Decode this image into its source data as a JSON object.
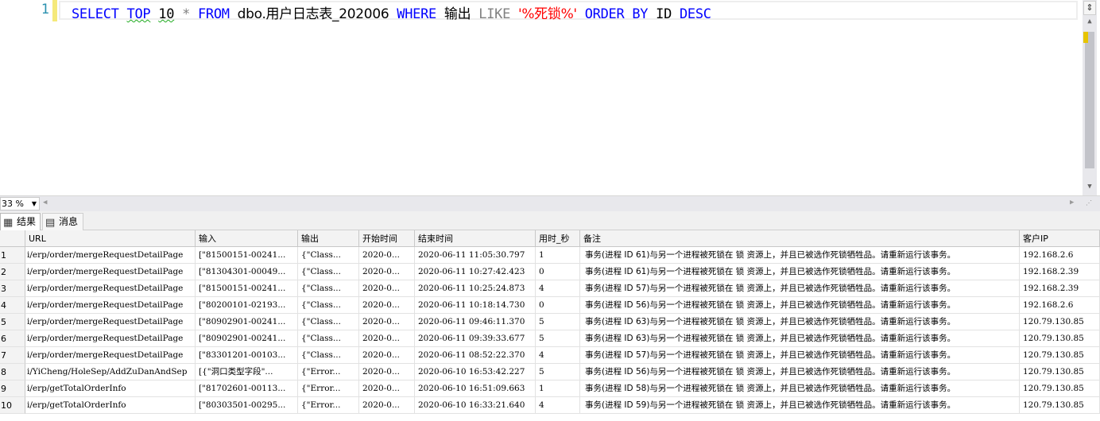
{
  "editor": {
    "line_number": "1",
    "query": {
      "kw_select": "SELECT",
      "kw_top": "TOP",
      "num": "10",
      "star": "*",
      "kw_from": "FROM",
      "table": "dbo.用户日志表_202006",
      "kw_where": "WHERE",
      "col": "输出",
      "kw_like": "LIKE",
      "pattern": "'%死锁%'",
      "kw_order": "ORDER BY",
      "order_col": "ID",
      "kw_desc": "DESC"
    }
  },
  "zoom": {
    "value": "33 %"
  },
  "tabs": {
    "results": "结果",
    "messages": "消息"
  },
  "grid": {
    "columns": [
      "URL",
      "输入",
      "输出",
      "开始时间",
      "结束时间",
      "用时_秒",
      "备注",
      "客户IP"
    ],
    "rows": [
      {
        "n": "1",
        "url": "i/erp/order/mergeRequestDetailPage",
        "input": "[\"81500151-00241...",
        "output": "{\"Class...",
        "start": "2020-0...",
        "end": "2020-06-11 11:05:30.797",
        "secs": "1",
        "note": "事务(进程 ID 61)与另一个进程被死锁在 锁 资源上，并且已被选作死锁牺牲品。请重新运行该事务。",
        "ip": "192.168.2.6"
      },
      {
        "n": "2",
        "url": "i/erp/order/mergeRequestDetailPage",
        "input": "[\"81304301-00049...",
        "output": "{\"Class...",
        "start": "2020-0...",
        "end": "2020-06-11 10:27:42.423",
        "secs": "0",
        "note": "事务(进程 ID 61)与另一个进程被死锁在 锁 资源上，并且已被选作死锁牺牲品。请重新运行该事务。",
        "ip": "192.168.2.39"
      },
      {
        "n": "3",
        "url": "i/erp/order/mergeRequestDetailPage",
        "input": "[\"81500151-00241...",
        "output": "{\"Class...",
        "start": "2020-0...",
        "end": "2020-06-11 10:25:24.873",
        "secs": "4",
        "note": "事务(进程 ID 57)与另一个进程被死锁在 锁 资源上，并且已被选作死锁牺牲品。请重新运行该事务。",
        "ip": "192.168.2.39"
      },
      {
        "n": "4",
        "url": "i/erp/order/mergeRequestDetailPage",
        "input": "[\"80200101-02193...",
        "output": "{\"Class...",
        "start": "2020-0...",
        "end": "2020-06-11 10:18:14.730",
        "secs": "0",
        "note": "事务(进程 ID 56)与另一个进程被死锁在 锁 资源上，并且已被选作死锁牺牲品。请重新运行该事务。",
        "ip": "192.168.2.6"
      },
      {
        "n": "5",
        "url": "i/erp/order/mergeRequestDetailPage",
        "input": "[\"80902901-00241...",
        "output": "{\"Class...",
        "start": "2020-0...",
        "end": "2020-06-11 09:46:11.370",
        "secs": "5",
        "note": "事务(进程 ID 63)与另一个进程被死锁在 锁 资源上，并且已被选作死锁牺牲品。请重新运行该事务。",
        "ip": "120.79.130.85"
      },
      {
        "n": "6",
        "url": "i/erp/order/mergeRequestDetailPage",
        "input": "[\"80902901-00241...",
        "output": "{\"Class...",
        "start": "2020-0...",
        "end": "2020-06-11 09:39:33.677",
        "secs": "5",
        "note": "事务(进程 ID 63)与另一个进程被死锁在 锁 资源上，并且已被选作死锁牺牲品。请重新运行该事务。",
        "ip": "120.79.130.85"
      },
      {
        "n": "7",
        "url": "i/erp/order/mergeRequestDetailPage",
        "input": "[\"83301201-00103...",
        "output": "{\"Class...",
        "start": "2020-0...",
        "end": "2020-06-11 08:52:22.370",
        "secs": "4",
        "note": "事务(进程 ID 57)与另一个进程被死锁在 锁 资源上，并且已被选作死锁牺牲品。请重新运行该事务。",
        "ip": "120.79.130.85"
      },
      {
        "n": "8",
        "url": "i/YiCheng/HoleSep/AddZuDanAndSep",
        "input": "[{\"洞口类型字段\"...",
        "output": "{\"Error...",
        "start": "2020-0...",
        "end": "2020-06-10 16:53:42.227",
        "secs": "5",
        "note": "事务(进程 ID 56)与另一个进程被死锁在 锁 资源上，并且已被选作死锁牺牲品。请重新运行该事务。",
        "ip": "120.79.130.85"
      },
      {
        "n": "9",
        "url": "i/erp/getTotalOrderInfo",
        "input": "[\"81702601-00113...",
        "output": "{\"Error...",
        "start": "2020-0...",
        "end": "2020-06-10 16:51:09.663",
        "secs": "1",
        "note": "事务(进程 ID 58)与另一个进程被死锁在 锁 资源上，并且已被选作死锁牺牲品。请重新运行该事务。",
        "ip": "120.79.130.85"
      },
      {
        "n": "10",
        "url": "i/erp/getTotalOrderInfo",
        "input": "[\"80303501-00295...",
        "output": "{\"Error...",
        "start": "2020-0...",
        "end": "2020-06-10 16:33:21.640",
        "secs": "4",
        "note": "事务(进程 ID 59)与另一个进程被死锁在 锁 资源上，并且已被选作死锁牺牲品。请重新运行该事务。",
        "ip": "120.79.130.85"
      }
    ]
  },
  "colors": {
    "keyword": "#0000ff",
    "string": "#ff0000",
    "line_number": "#2b91af",
    "operator": "#808080"
  }
}
